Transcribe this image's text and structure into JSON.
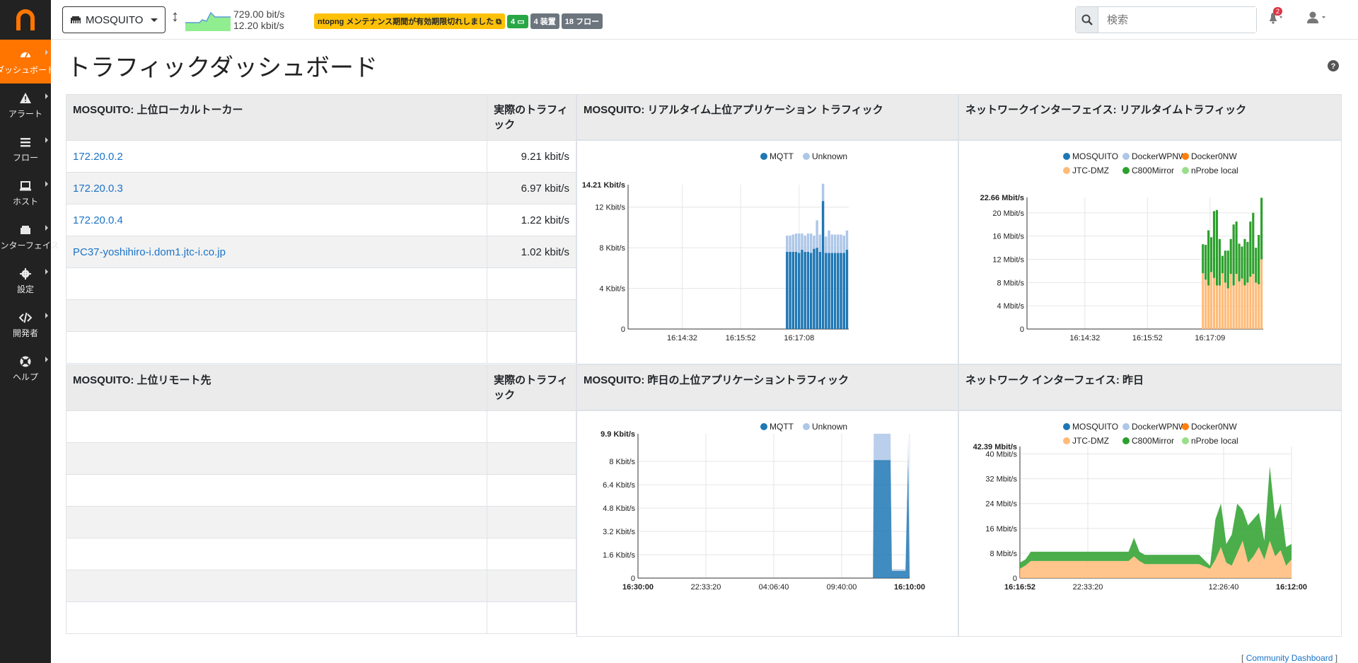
{
  "sidebar": {
    "items": [
      {
        "label": "ダッシュボード",
        "icon": "gauge-icon"
      },
      {
        "label": "アラート",
        "icon": "warning-icon"
      },
      {
        "label": "フロー",
        "icon": "list-icon"
      },
      {
        "label": "ホスト",
        "icon": "laptop-icon"
      },
      {
        "label": "インターフェイス",
        "icon": "ethernet-icon"
      },
      {
        "label": "設定",
        "icon": "gear-icon"
      },
      {
        "label": "開発者",
        "icon": "code-icon"
      },
      {
        "label": "ヘルプ",
        "icon": "lifebuoy-icon"
      }
    ]
  },
  "topbar": {
    "interface": "MOSQUITO",
    "throughput_up": "729.00 bit/s",
    "throughput_down": "12.20 kbit/s",
    "license_warning": "ntopng メンテナンス期間が有効期限切れしました",
    "badge_local_hosts": "4",
    "badge_devices": "4 装置",
    "badge_flows": "18 フロー",
    "search_placeholder": "検索",
    "alert_count": "2"
  },
  "page": {
    "title": "トラフィックダッシュボード",
    "footer_left": "[",
    "footer_link": "Community Dashboard",
    "footer_right": "]"
  },
  "colors": {
    "accent": "#ff7500",
    "mqtt": "#1f77b4",
    "unknown": "#aec7e8",
    "mosquito": "#1f77b4",
    "dockerwpnw": "#aec7e8",
    "docker0nw": "#ff7f0e",
    "jtcdmz": "#ffbb78",
    "c800mirror": "#2ca02c",
    "nprobe": "#98df8a"
  },
  "top_local": {
    "header_name": "MOSQUITO: 上位ローカルトーカー",
    "header_value": "実際のトラフィック",
    "rows": [
      {
        "host": "172.20.0.2",
        "value": "9.21 kbit/s"
      },
      {
        "host": "172.20.0.3",
        "value": "6.97 kbit/s"
      },
      {
        "host": "172.20.0.4",
        "value": "1.22 kbit/s"
      },
      {
        "host": "PC37-yoshihiro-i.dom1.jtc-i.co.jp",
        "value": "1.02 kbit/s"
      }
    ]
  },
  "top_remote": {
    "header_name": "MOSQUITO: 上位リモート先",
    "header_value": "実際のトラフィック"
  },
  "chart_titles": {
    "rt_apps": "MOSQUITO: リアルタイム上位アプリケーション トラフィック",
    "rt_ifaces": "ネットワークインターフェイス: リアルタイムトラフィック",
    "yd_apps": "MOSQUITO: 昨日の上位アプリケーショントラフィック",
    "yd_ifaces": "ネットワーク インターフェイス: 昨日"
  },
  "chart_data": [
    {
      "type": "bar",
      "stacked": true,
      "legend": [
        "MQTT",
        "Unknown"
      ],
      "legend_position": "top-right",
      "y_max_label": "14.21 Kbit/s",
      "ylim": [
        0,
        14.21
      ],
      "y_ticks": [
        "0",
        "4 Kbit/s",
        "8 Kbit/s",
        "12 Kbit/s"
      ],
      "x_ticks": [
        "16:14:32",
        "16:15:52",
        "16:17:08"
      ],
      "series": [
        {
          "name": "MQTT",
          "values": [
            7.6,
            7.6,
            7.6,
            7.6,
            7.5,
            7.8,
            7.6,
            7.6,
            7.5,
            7.9,
            8.0,
            7.6,
            12.6,
            7.5,
            7.5,
            7.5,
            7.5,
            7.5,
            7.5,
            7.5,
            7.8
          ]
        },
        {
          "name": "Unknown",
          "values": [
            1.6,
            1.6,
            1.7,
            1.8,
            1.9,
            1.6,
            1.6,
            1.8,
            1.9,
            1.3,
            2.7,
            1.7,
            1.7,
            1.6,
            2.2,
            1.8,
            1.8,
            1.8,
            1.8,
            1.7,
            1.9
          ]
        }
      ]
    },
    {
      "type": "bar",
      "stacked": true,
      "legend": [
        "MOSQUITO",
        "DockerWPNW",
        "Docker0NW",
        "JTC-DMZ",
        "C800Mirror",
        "nProbe local"
      ],
      "legend_position": "top",
      "y_max_label": "22.66 Mbit/s",
      "ylim": [
        0,
        22.66
      ],
      "y_ticks": [
        "0",
        "4 Mbit/s",
        "8 Mbit/s",
        "12 Mbit/s",
        "16 Mbit/s",
        "20 Mbit/s"
      ],
      "x_ticks": [
        "16:14:32",
        "16:15:52",
        "16:17:09"
      ],
      "series": [
        {
          "name": "JTC-DMZ",
          "values": [
            9.6,
            8.5,
            7.5,
            9.8,
            8.8,
            7.5,
            7.5,
            9.6,
            8.0,
            7.0,
            9.5,
            7.5,
            9.5,
            8.2,
            8.7,
            7.5,
            8.0,
            9.0,
            9.5,
            8.0,
            7.7,
            12.0
          ]
        },
        {
          "name": "C800Mirror",
          "values": [
            5.0,
            6.0,
            9.5,
            6.0,
            11.5,
            13.0,
            8.0,
            3.0,
            5.5,
            6.5,
            6.0,
            10.5,
            9.0,
            6.5,
            5.5,
            8.0,
            7.0,
            9.5,
            10.5,
            6.0,
            8.5,
            10.6
          ]
        }
      ]
    },
    {
      "type": "area",
      "stacked": true,
      "legend": [
        "MQTT",
        "Unknown"
      ],
      "legend_position": "top-right",
      "y_max_label": "9.9 Kbit/s",
      "ylim": [
        0,
        9.9
      ],
      "y_ticks": [
        "0",
        "1.6 Kbit/s",
        "3.2 Kbit/s",
        "4.8 Kbit/s",
        "6.4 Kbit/s",
        "8 Kbit/s"
      ],
      "x_ticks": [
        "16:30:00",
        "22:33:20",
        "04:06:40",
        "09:40:00",
        "16:10:00"
      ],
      "series": [
        {
          "name": "MQTT",
          "x": [
            0,
            0.85,
            0.865,
            0.868,
            0.93,
            0.935,
            0.98,
            0.985,
            0.995,
            1
          ],
          "values": [
            0,
            0,
            0,
            8.1,
            8.1,
            0.5,
            0.5,
            0.5,
            8.5,
            0
          ]
        },
        {
          "name": "Unknown",
          "x": [
            0,
            0.85,
            0.865,
            0.868,
            0.93,
            0.935,
            0.98,
            0.985,
            0.995,
            1
          ],
          "values": [
            0,
            0,
            0,
            1.8,
            1.8,
            0.1,
            0.1,
            0.1,
            1.2,
            0
          ]
        }
      ]
    },
    {
      "type": "area",
      "stacked": true,
      "legend": [
        "MOSQUITO",
        "DockerWPNW",
        "Docker0NW",
        "JTC-DMZ",
        "C800Mirror",
        "nProbe local"
      ],
      "legend_position": "top",
      "y_max_label": "42.39 Mbit/s",
      "ylim": [
        0,
        42.39
      ],
      "y_ticks": [
        "0",
        "8 Mbit/s",
        "16 Mbit/s",
        "24 Mbit/s",
        "32 Mbit/s",
        "40 Mbit/s"
      ],
      "x_ticks": [
        "16:16:52",
        "22:33:20",
        "12:26:40",
        "16:12:00"
      ],
      "series": [
        {
          "name": "JTC-DMZ",
          "x": [
            0,
            0.02,
            0.04,
            0.1,
            0.3,
            0.4,
            0.42,
            0.44,
            0.46,
            0.6,
            0.66,
            0.7,
            0.72,
            0.74,
            0.76,
            0.78,
            0.8,
            0.82,
            0.84,
            0.86,
            0.88,
            0.9,
            0.92,
            0.94,
            0.96,
            0.98,
            1
          ],
          "values": [
            3,
            4,
            5.5,
            5.5,
            5.5,
            5.5,
            7,
            5.5,
            4.5,
            4.5,
            4.5,
            3,
            6,
            10,
            5,
            4,
            8,
            12,
            5,
            7,
            10,
            6,
            12,
            7,
            9,
            4,
            6
          ]
        },
        {
          "name": "C800Mirror",
          "x": [
            0,
            0.02,
            0.04,
            0.1,
            0.3,
            0.4,
            0.42,
            0.44,
            0.46,
            0.6,
            0.66,
            0.7,
            0.72,
            0.74,
            0.76,
            0.78,
            0.8,
            0.82,
            0.84,
            0.86,
            0.88,
            0.9,
            0.92,
            0.94,
            0.96,
            0.98,
            1
          ],
          "values": [
            2,
            2,
            3,
            3,
            3,
            3,
            6,
            3,
            3,
            3,
            3,
            1,
            13,
            14,
            6,
            10,
            16,
            10,
            12,
            12,
            11,
            6,
            24,
            12,
            15,
            6,
            5
          ]
        }
      ]
    }
  ]
}
